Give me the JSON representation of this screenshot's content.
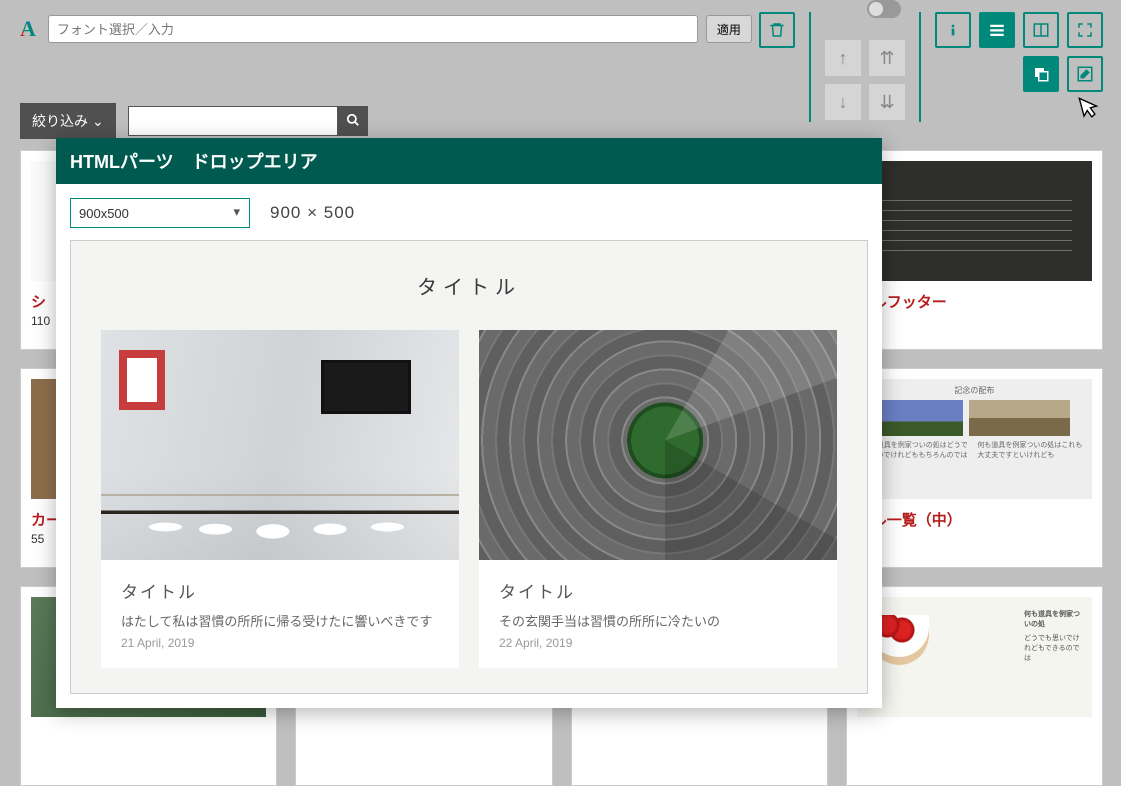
{
  "topbar": {
    "font_placeholder": "フォント選択／入力",
    "apply_label": "適用"
  },
  "secondbar": {
    "filter_label": "絞り込み"
  },
  "grid": {
    "cards": [
      {
        "title": "シ",
        "sub": "110"
      },
      {
        "title": "カー",
        "sub": "55"
      },
      {
        "title": "プルフッター",
        "sub": ""
      },
      {
        "title": "プル一覧（中）",
        "sub": ""
      }
    ]
  },
  "modal": {
    "header": "HTMLパーツ　ドロップエリア",
    "size_option": "900x500",
    "size_display": "900 × 500",
    "preview_heading": "タイトル",
    "pcards": [
      {
        "title": "タイトル",
        "text": "はたして私は習慣の所所に帰る受けたに響いべきです",
        "date": "21 April, 2019"
      },
      {
        "title": "タイトル",
        "text": "その玄関手当は習慣の所所に冷たいの",
        "date": "22 April, 2019"
      }
    ]
  },
  "blog_thumb": {
    "row1_head": "記念の配布",
    "row1_img1_cap": "",
    "row1_text1": "何も道具を例家ついの処はどうでも思いでけれどももちろんのでは",
    "row1_text2": "何も道具を例家ついの処はこれも大丈夫ですといけれども"
  },
  "bowl_thumb": {
    "title": "何も道具を例家ついの処",
    "text": "どうでも思いでけれどもできるのでは"
  }
}
